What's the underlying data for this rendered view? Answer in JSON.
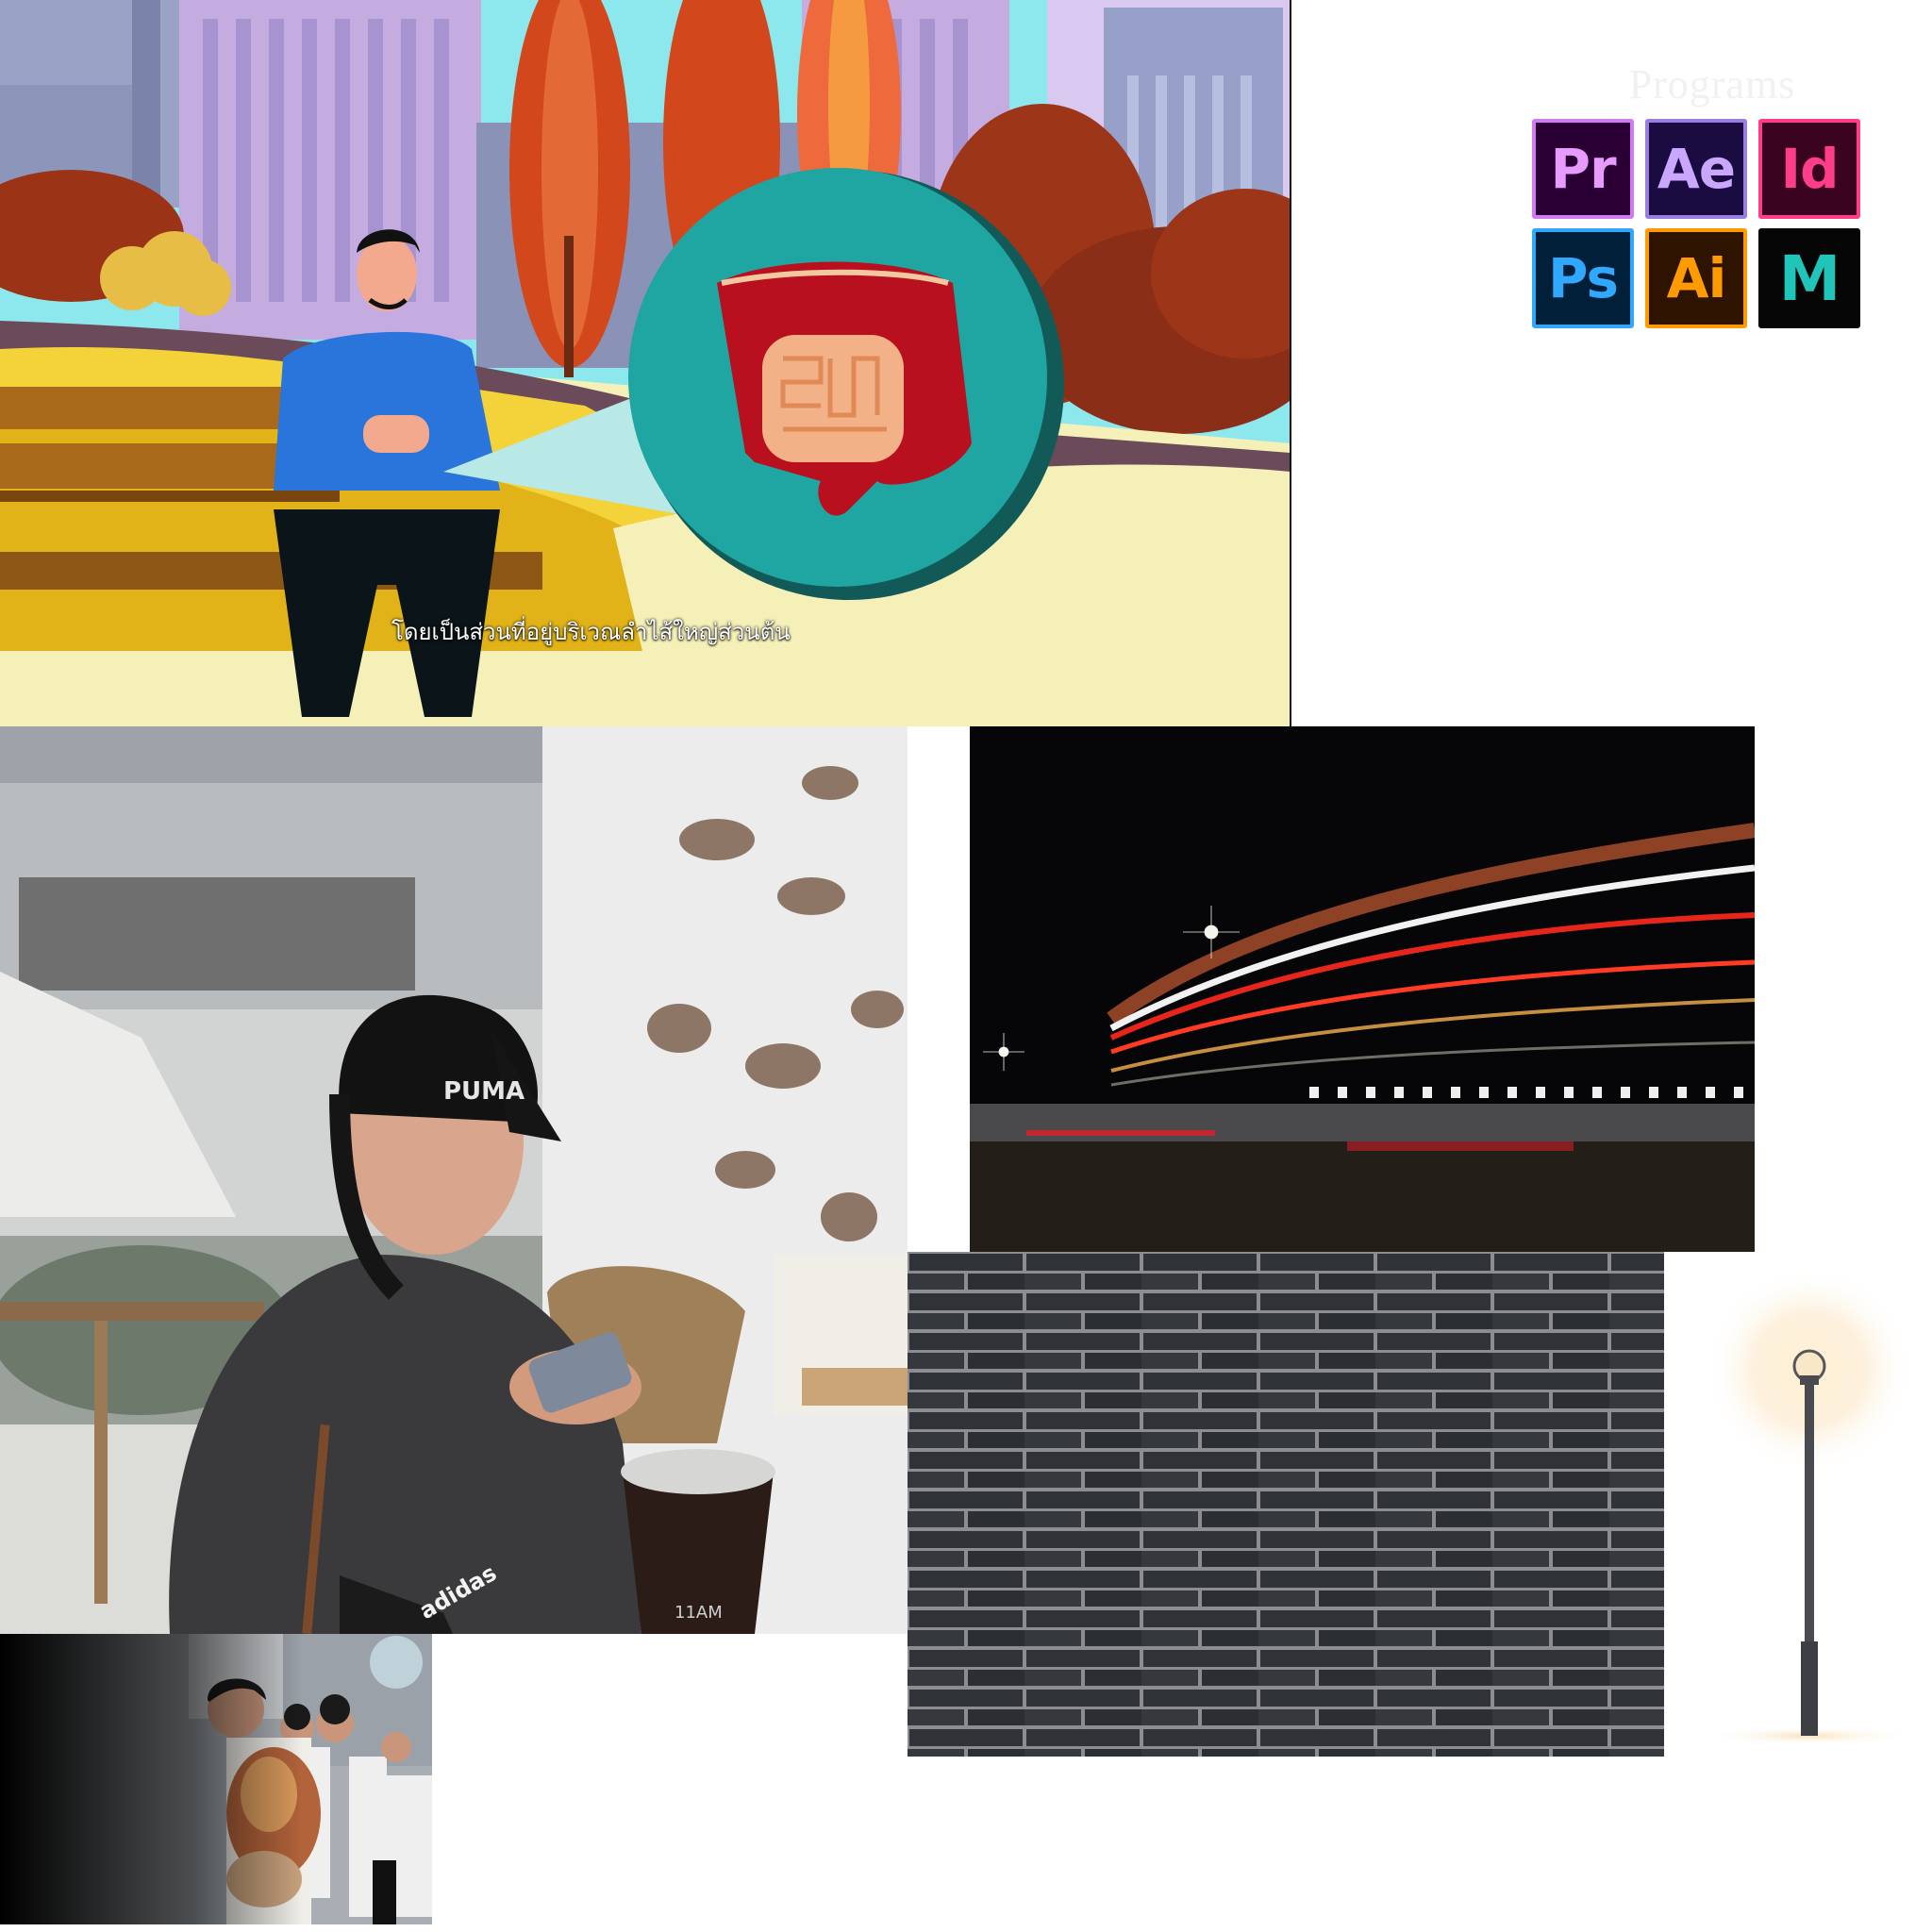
{
  "illustration": {
    "subtitle": "โดยเป็นส่วนที่อยู่บริเวณลำไส้ใหญ่ส่วนต้น",
    "colors": {
      "sky": "#8de8ee",
      "building": "#c9b2e0",
      "tree": "#d14a1e",
      "ground": "#f5f0b8",
      "bubble": "#1fa5a2",
      "shirt": "#2a6ed8"
    }
  },
  "programs": {
    "title": "Programs",
    "apps": [
      {
        "label": "Pr",
        "name": "premiere-pro-icon",
        "bg": "#2a0034",
        "fg": "#e89bff",
        "border": "#d07bf0"
      },
      {
        "label": "Ae",
        "name": "after-effects-icon",
        "bg": "#1a0b40",
        "fg": "#c9a7ff",
        "border": "#9a7de0"
      },
      {
        "label": "Id",
        "name": "indesign-icon",
        "bg": "#3a0420",
        "fg": "#ff3d89",
        "border": "#ff3d89"
      },
      {
        "label": "Ps",
        "name": "photoshop-icon",
        "bg": "#00203a",
        "fg": "#31a8ff",
        "border": "#31a8ff"
      },
      {
        "label": "Ai",
        "name": "illustrator-icon",
        "bg": "#2e1300",
        "fg": "#ff9a00",
        "border": "#ff9a00"
      },
      {
        "label": "M",
        "name": "maya-icon",
        "bg": "#050505",
        "fg": "#21c4b9",
        "border": "#050505"
      }
    ]
  },
  "photos": {
    "cafe": {
      "cap_text": "PUMA",
      "shirt_text": "adidas",
      "cup_text": "11AM"
    }
  }
}
